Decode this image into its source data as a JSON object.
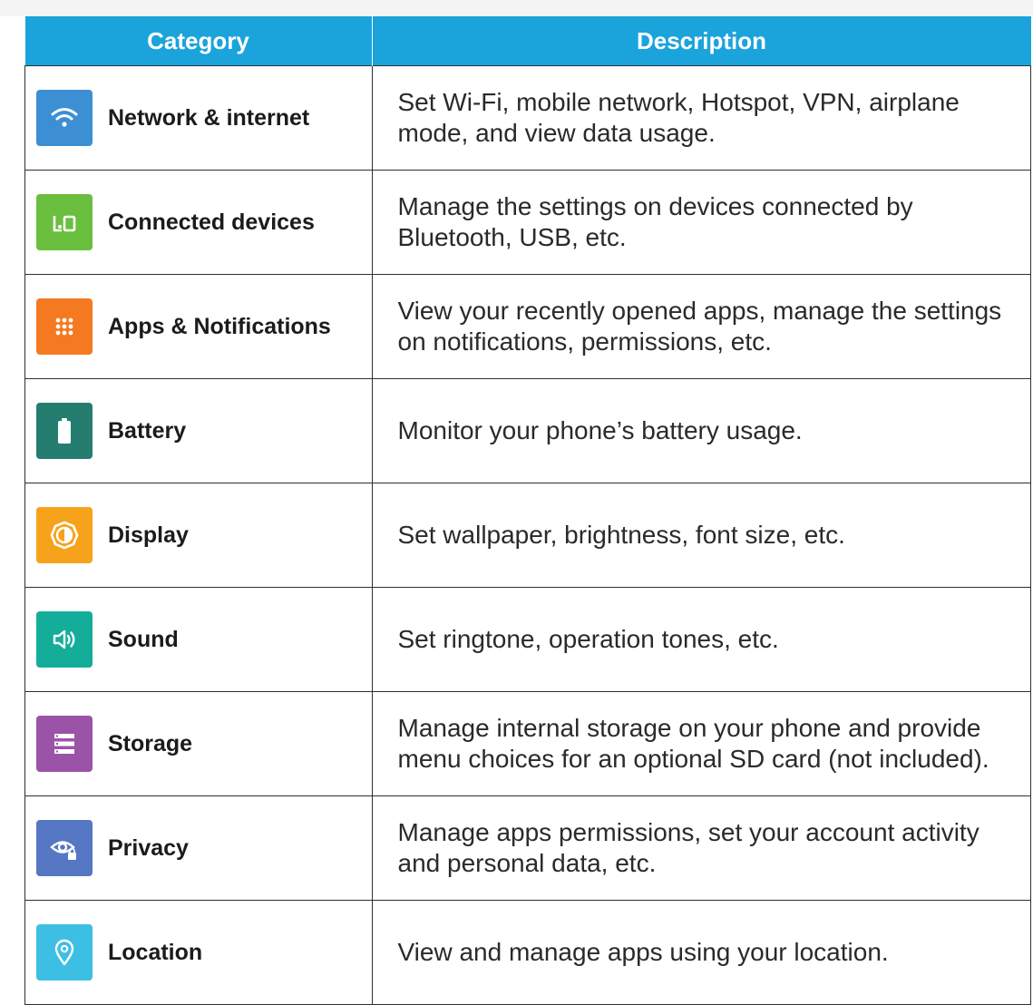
{
  "table": {
    "headers": {
      "category": "Category",
      "description": "Description"
    },
    "rows": [
      {
        "label": "Network & internet",
        "description": "Set Wi-Fi, mobile network, Hotspot, VPN, airplane mode, and view data usage.",
        "icon": "wifi-icon",
        "color": "#3c8fd3"
      },
      {
        "label": "Connected devices",
        "description": "Manage the settings on devices connected by Bluetooth, USB, etc.",
        "icon": "connected-devices-icon",
        "color": "#6bbf3e"
      },
      {
        "label": "Apps & Notifications",
        "description": "View your recently opened apps, manage the settings on notifications, permissions, etc.",
        "icon": "apps-grid-icon",
        "color": "#f47920"
      },
      {
        "label": "Battery",
        "description": "Monitor your phone’s battery usage.",
        "icon": "battery-icon",
        "color": "#247d6f"
      },
      {
        "label": "Display",
        "description": "Set wallpaper, brightness, font size, etc.",
        "icon": "brightness-icon",
        "color": "#f7a21b"
      },
      {
        "label": "Sound",
        "description": "Set ringtone, operation tones, etc.",
        "icon": "speaker-icon",
        "color": "#14ad9a"
      },
      {
        "label": "Storage",
        "description": "Manage internal storage on your phone and provide menu choices for an optional SD card (not included).",
        "icon": "storage-icon",
        "color": "#9b53a8"
      },
      {
        "label": "Privacy",
        "description": "Manage apps permissions, set your account activity and personal data, etc.",
        "icon": "privacy-eye-icon",
        "color": "#5577c4"
      },
      {
        "label": "Location",
        "description": "View and manage apps using your location.",
        "icon": "location-pin-icon",
        "color": "#3dbfe4"
      }
    ]
  }
}
